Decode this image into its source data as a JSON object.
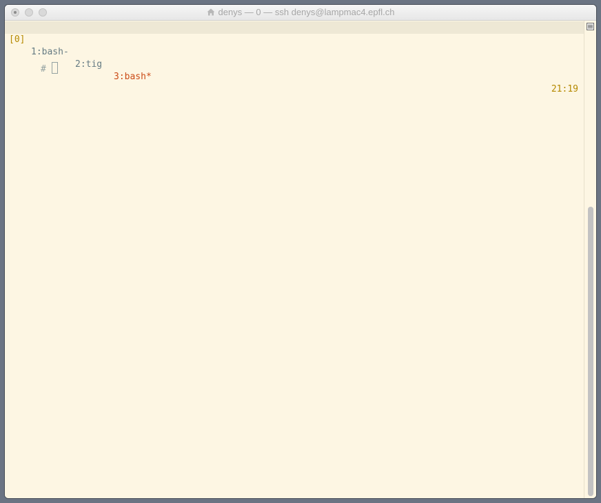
{
  "window": {
    "title": "denys — 0 — ssh denys@lampmac4.epfl.ch",
    "title_icon": "home-icon"
  },
  "tmux": {
    "session": "[0]",
    "windows": [
      {
        "label": "1:bash-",
        "active": false
      },
      {
        "label": "2:tig",
        "active": false
      },
      {
        "label": "3:bash*",
        "active": true
      }
    ],
    "clock": "21:19"
  },
  "terminal": {
    "prompt": "#"
  },
  "colors": {
    "background": "#fdf6e3",
    "statusbar": "#eee8d5",
    "session": "#b58900",
    "inactive_window": "#657b83",
    "active_window": "#cb4b16"
  }
}
